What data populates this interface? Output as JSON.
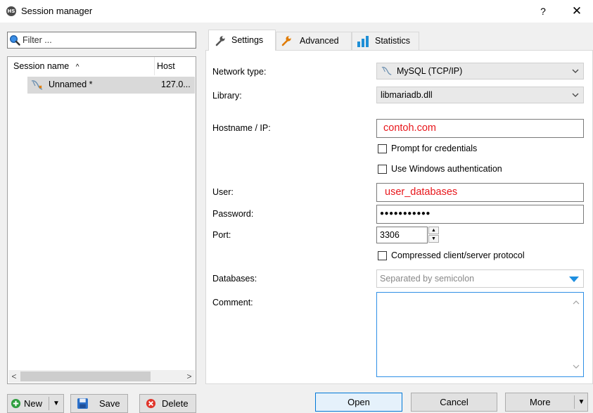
{
  "window": {
    "title": "Session manager",
    "icon_text": "HS",
    "help": "?",
    "close": "✕"
  },
  "filter": {
    "placeholder": "Filter ..."
  },
  "sessions": {
    "columns": [
      "Session name",
      "Host"
    ],
    "sort_indicator": "^",
    "rows": [
      {
        "name": "Unnamed *",
        "host": "127.0..."
      }
    ]
  },
  "bottom_left": {
    "new": "New",
    "save": "Save",
    "delete": "Delete"
  },
  "tabs": [
    "Settings",
    "Advanced",
    "Statistics"
  ],
  "form": {
    "network_type_label": "Network type:",
    "network_type_value": "MySQL (TCP/IP)",
    "library_label": "Library:",
    "library_value": "libmariadb.dll",
    "hostname_label": "Hostname / IP:",
    "hostname_value": "contoh.com",
    "prompt_credentials": "Prompt for credentials",
    "windows_auth": "Use Windows authentication",
    "user_label": "User:",
    "user_value": "user_databases",
    "password_label": "Password:",
    "password_value": "●●●●●●●●●●●",
    "port_label": "Port:",
    "port_value": "3306",
    "compressed": "Compressed client/server protocol",
    "databases_label": "Databases:",
    "databases_placeholder": "Separated by semicolon",
    "comment_label": "Comment:"
  },
  "bottom_right": {
    "open": "Open",
    "cancel": "Cancel",
    "more": "More"
  },
  "colors": {
    "red_text": "#e8161b",
    "selection": "#d9d9d9",
    "accent": "#0078d7"
  }
}
